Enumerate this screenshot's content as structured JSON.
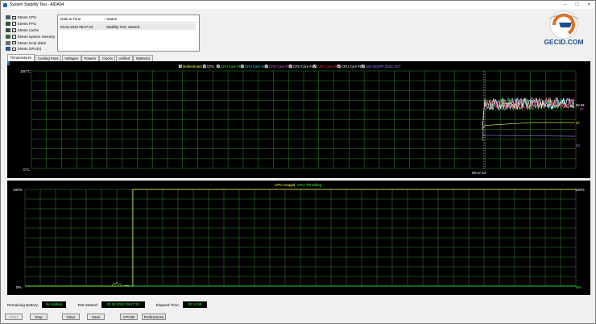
{
  "window": {
    "title": "System Stability Test - AIDA64"
  },
  "options": [
    {
      "label": "Stress CPU",
      "checked": true,
      "icon": "cpu-icon"
    },
    {
      "label": "Stress FPU",
      "checked": true,
      "icon": "fpu-icon"
    },
    {
      "label": "Stress cache",
      "checked": true,
      "icon": "cache-icon"
    },
    {
      "label": "Stress system memory",
      "checked": true,
      "icon": "memory-icon"
    },
    {
      "label": "Stress local disks",
      "checked": false,
      "icon": "disk-icon"
    },
    {
      "label": "Stress GPU(s)",
      "checked": false,
      "icon": "gpu-icon"
    }
  ],
  "status_table": {
    "headers": [
      "Date & Time",
      "Status"
    ],
    "rows": [
      {
        "datetime": "03.02.2022 09:47:23",
        "status": "Stability Test: Started"
      }
    ]
  },
  "logo": {
    "text": "GECID.COM"
  },
  "tabs": [
    "Temperatures",
    "Cooling Fans",
    "Voltages",
    "Powers",
    "Clocks",
    "Unified",
    "Statistics"
  ],
  "temp_chart": {
    "legend": [
      {
        "label": "Motherboard",
        "color": "#ffff50"
      },
      {
        "label": "CPU",
        "color": "#ffffff"
      },
      {
        "label": "CPU Core #1",
        "color": "#40ff40"
      },
      {
        "label": "CPU Core #2",
        "color": "#40e0ff"
      },
      {
        "label": "CPU Core #3",
        "color": "#ff60ff"
      },
      {
        "label": "CPU Core #4",
        "color": "#ffffff"
      },
      {
        "label": "CPU Core #5",
        "color": "#ff4040"
      },
      {
        "label": "CPU Core #6",
        "color": "#ffffff"
      },
      {
        "label": "WD-S3DPR-3ZSC-D1T",
        "color": "#a080ff"
      }
    ],
    "y_top": "100°C",
    "y_bottom": "0°C",
    "x_time": "09:47:23",
    "right_values": [
      {
        "text": "68 69",
        "color": "#ffffff"
      },
      {
        "text": "67",
        "color": "#ff60ff"
      },
      {
        "text": "47",
        "color": "#ffff50"
      },
      {
        "text": "33",
        "color": "#a080ff"
      }
    ]
  },
  "usage_chart": {
    "legend": [
      {
        "label": "CPU Usage",
        "color": "#ffff50"
      },
      {
        "label": "CPU Throttling",
        "color": "#40ff40"
      }
    ],
    "separator": "|",
    "y_top": "100%",
    "y_bottom": "0%",
    "y_top_right": "100%",
    "y_bottom_right": "0%"
  },
  "bottom_info": {
    "battery_label": "Remaining Battery:",
    "battery_value": "No battery",
    "started_label": "Test Started:",
    "started_value": "03.02.2022 09:47:23",
    "elapsed_label": "Elapsed Time:",
    "elapsed_value": "00:11:59"
  },
  "buttons": {
    "start": "Start",
    "stop": "Stop",
    "clear": "Clear",
    "save": "Save",
    "cpuid": "CPUID",
    "preferences": "Preferences"
  },
  "colors": {
    "grid": "#2e8a2e",
    "chart_bg": "#000000",
    "value_green": "#3cff3c"
  }
}
